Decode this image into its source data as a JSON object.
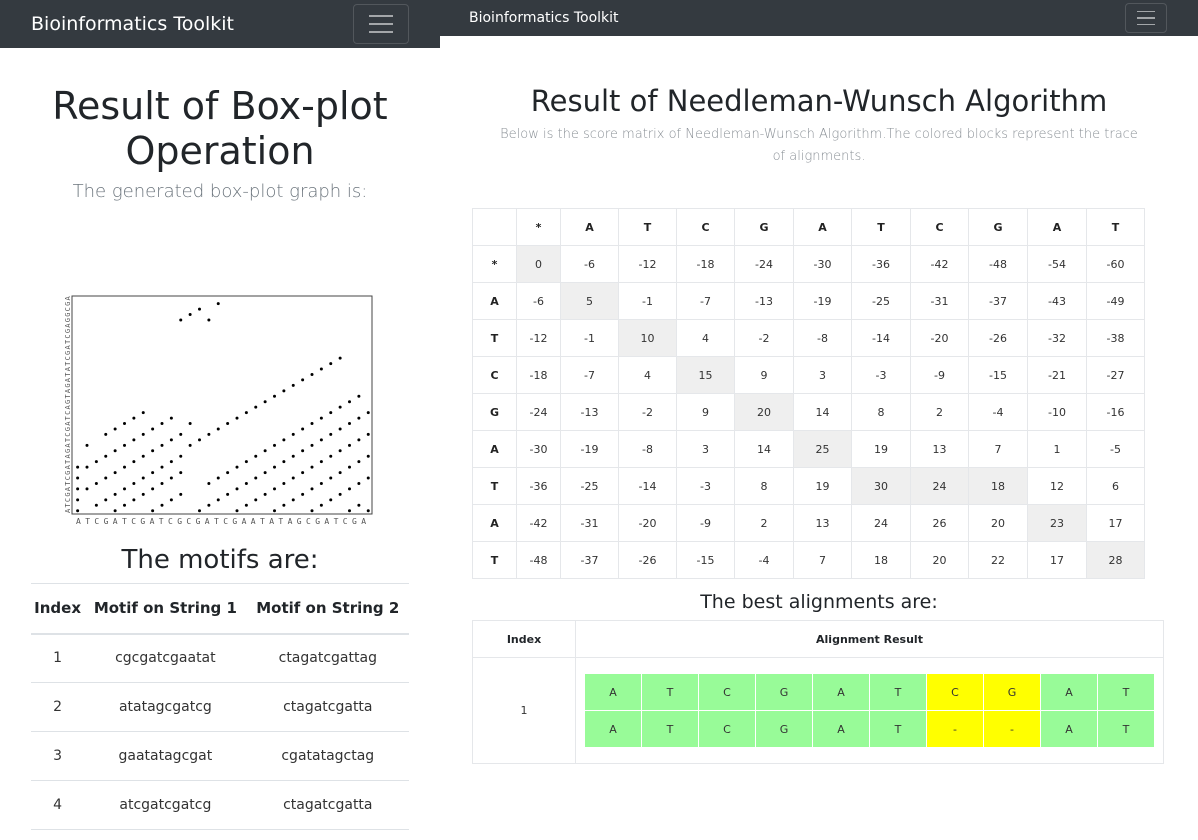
{
  "left": {
    "brand": "Bioinformatics Toolkit",
    "title": "Result of Box-plot Operation",
    "subtitle": "The generated box-plot graph is:",
    "plot": {
      "seq_x": "ATCGATCGATCGCGATCGAATATAGCGATCGA",
      "seq_y": "ATCGATCGATAGATCGATCAGTAGATATCGATCGAGGCGA",
      "points": [
        [
          0,
          0
        ],
        [
          0,
          2
        ],
        [
          0,
          4
        ],
        [
          0,
          6
        ],
        [
          0,
          8
        ],
        [
          1,
          4
        ],
        [
          1,
          8
        ],
        [
          1,
          12
        ],
        [
          2,
          1
        ],
        [
          2,
          5
        ],
        [
          2,
          9
        ],
        [
          3,
          2
        ],
        [
          3,
          6
        ],
        [
          3,
          10
        ],
        [
          3,
          14
        ],
        [
          4,
          0
        ],
        [
          4,
          3
        ],
        [
          4,
          7
        ],
        [
          4,
          11
        ],
        [
          4,
          15
        ],
        [
          5,
          1
        ],
        [
          5,
          4
        ],
        [
          5,
          8
        ],
        [
          5,
          12
        ],
        [
          5,
          16
        ],
        [
          6,
          2
        ],
        [
          6,
          5
        ],
        [
          6,
          9
        ],
        [
          6,
          13
        ],
        [
          6,
          17
        ],
        [
          7,
          3
        ],
        [
          7,
          6
        ],
        [
          7,
          10
        ],
        [
          7,
          14
        ],
        [
          7,
          18
        ],
        [
          8,
          0
        ],
        [
          8,
          4
        ],
        [
          8,
          7
        ],
        [
          8,
          11
        ],
        [
          8,
          15
        ],
        [
          9,
          1
        ],
        [
          9,
          5
        ],
        [
          9,
          8
        ],
        [
          9,
          12
        ],
        [
          9,
          16
        ],
        [
          10,
          2
        ],
        [
          10,
          6
        ],
        [
          10,
          9
        ],
        [
          10,
          13
        ],
        [
          10,
          17
        ],
        [
          11,
          3
        ],
        [
          11,
          7
        ],
        [
          11,
          10
        ],
        [
          11,
          14
        ],
        [
          11,
          35
        ],
        [
          12,
          36
        ],
        [
          12,
          12
        ],
        [
          12,
          16
        ],
        [
          13,
          0
        ],
        [
          13,
          13
        ],
        [
          13,
          37
        ],
        [
          14,
          1
        ],
        [
          14,
          5
        ],
        [
          14,
          14
        ],
        [
          14,
          35
        ],
        [
          15,
          2
        ],
        [
          15,
          6
        ],
        [
          15,
          15
        ],
        [
          15,
          38
        ],
        [
          16,
          3
        ],
        [
          16,
          7
        ],
        [
          16,
          16
        ],
        [
          17,
          0
        ],
        [
          17,
          4
        ],
        [
          17,
          8
        ],
        [
          17,
          17
        ],
        [
          18,
          1
        ],
        [
          18,
          5
        ],
        [
          18,
          9
        ],
        [
          18,
          18
        ],
        [
          19,
          2
        ],
        [
          19,
          6
        ],
        [
          19,
          10
        ],
        [
          19,
          19
        ],
        [
          20,
          3
        ],
        [
          20,
          7
        ],
        [
          20,
          11
        ],
        [
          20,
          20
        ],
        [
          21,
          0
        ],
        [
          21,
          4
        ],
        [
          21,
          8
        ],
        [
          21,
          12
        ],
        [
          21,
          21
        ],
        [
          22,
          1
        ],
        [
          22,
          5
        ],
        [
          22,
          9
        ],
        [
          22,
          13
        ],
        [
          22,
          22
        ],
        [
          23,
          2
        ],
        [
          23,
          6
        ],
        [
          23,
          10
        ],
        [
          23,
          14
        ],
        [
          23,
          23
        ],
        [
          24,
          3
        ],
        [
          24,
          7
        ],
        [
          24,
          11
        ],
        [
          24,
          15
        ],
        [
          24,
          24
        ],
        [
          25,
          0
        ],
        [
          25,
          4
        ],
        [
          25,
          8
        ],
        [
          25,
          12
        ],
        [
          25,
          16
        ],
        [
          25,
          25
        ],
        [
          26,
          1
        ],
        [
          26,
          5
        ],
        [
          26,
          9
        ],
        [
          26,
          13
        ],
        [
          26,
          17
        ],
        [
          26,
          26
        ],
        [
          27,
          2
        ],
        [
          27,
          6
        ],
        [
          27,
          10
        ],
        [
          27,
          14
        ],
        [
          27,
          18
        ],
        [
          27,
          27
        ],
        [
          28,
          3
        ],
        [
          28,
          7
        ],
        [
          28,
          11
        ],
        [
          28,
          15
        ],
        [
          28,
          19
        ],
        [
          28,
          28
        ],
        [
          29,
          0
        ],
        [
          29,
          4
        ],
        [
          29,
          8
        ],
        [
          29,
          12
        ],
        [
          29,
          16
        ],
        [
          29,
          20
        ],
        [
          30,
          1
        ],
        [
          30,
          5
        ],
        [
          30,
          9
        ],
        [
          30,
          13
        ],
        [
          30,
          17
        ],
        [
          30,
          21
        ],
        [
          31,
          0
        ],
        [
          31,
          6
        ],
        [
          31,
          10
        ],
        [
          31,
          14
        ],
        [
          31,
          18
        ]
      ]
    },
    "motifs_title": "The motifs are:",
    "motif_headers": [
      "Index",
      "Motif on String 1",
      "Motif on String 2"
    ],
    "motifs": [
      [
        "1",
        "cgcgatcgaatat",
        "ctagatcgattag"
      ],
      [
        "2",
        "atatagcgatcg",
        "ctagatcgatta"
      ],
      [
        "3",
        "gaatatagcgat",
        "cgatatagctag"
      ],
      [
        "4",
        "atcgatcgatcg",
        "ctagatcgatta"
      ]
    ]
  },
  "right": {
    "brand": "Bioinformatics Toolkit",
    "title": "Result of Needleman-Wunsch Algorithm",
    "subtitle": "Below is the score matrix of Needleman-Wunsch Algorithm.The colored blocks represent the trace of alignments.",
    "matrix": {
      "cols": [
        "",
        "*",
        "A",
        "T",
        "C",
        "G",
        "A",
        "T",
        "C",
        "G",
        "A",
        "T"
      ],
      "rows": [
        {
          "h": "*",
          "v": [
            "0",
            "-6",
            "-12",
            "-18",
            "-24",
            "-30",
            "-36",
            "-42",
            "-48",
            "-54",
            "-60"
          ],
          "hl": [
            0
          ]
        },
        {
          "h": "A",
          "v": [
            "-6",
            "5",
            "-1",
            "-7",
            "-13",
            "-19",
            "-25",
            "-31",
            "-37",
            "-43",
            "-49"
          ],
          "hl": [
            1
          ]
        },
        {
          "h": "T",
          "v": [
            "-12",
            "-1",
            "10",
            "4",
            "-2",
            "-8",
            "-14",
            "-20",
            "-26",
            "-32",
            "-38"
          ],
          "hl": [
            2
          ]
        },
        {
          "h": "C",
          "v": [
            "-18",
            "-7",
            "4",
            "15",
            "9",
            "3",
            "-3",
            "-9",
            "-15",
            "-21",
            "-27"
          ],
          "hl": [
            3
          ]
        },
        {
          "h": "G",
          "v": [
            "-24",
            "-13",
            "-2",
            "9",
            "20",
            "14",
            "8",
            "2",
            "-4",
            "-10",
            "-16"
          ],
          "hl": [
            4
          ]
        },
        {
          "h": "A",
          "v": [
            "-30",
            "-19",
            "-8",
            "3",
            "14",
            "25",
            "19",
            "13",
            "7",
            "1",
            "-5"
          ],
          "hl": [
            5
          ]
        },
        {
          "h": "T",
          "v": [
            "-36",
            "-25",
            "-14",
            "-3",
            "8",
            "19",
            "30",
            "24",
            "18",
            "12",
            "6"
          ],
          "hl": [
            6,
            7,
            8
          ]
        },
        {
          "h": "A",
          "v": [
            "-42",
            "-31",
            "-20",
            "-9",
            "2",
            "13",
            "24",
            "26",
            "20",
            "23",
            "17"
          ],
          "hl": [
            9
          ]
        },
        {
          "h": "T",
          "v": [
            "-48",
            "-37",
            "-26",
            "-15",
            "-4",
            "7",
            "18",
            "20",
            "22",
            "17",
            "28"
          ],
          "hl": [
            10
          ]
        }
      ]
    },
    "best_title": "The best alignments are:",
    "align_headers": [
      "Index",
      "Alignment Result"
    ],
    "alignments": [
      {
        "index": "1",
        "top": [
          "A",
          "T",
          "C",
          "G",
          "A",
          "T",
          "C",
          "G",
          "A",
          "T"
        ],
        "bottom": [
          "A",
          "T",
          "C",
          "G",
          "A",
          "T",
          "-",
          "-",
          "A",
          "T"
        ],
        "mismatch": [
          6,
          7
        ]
      }
    ],
    "colors": {
      "match": "#98fb98",
      "mismatch": "#ffff00",
      "trace": "#efefef"
    }
  }
}
